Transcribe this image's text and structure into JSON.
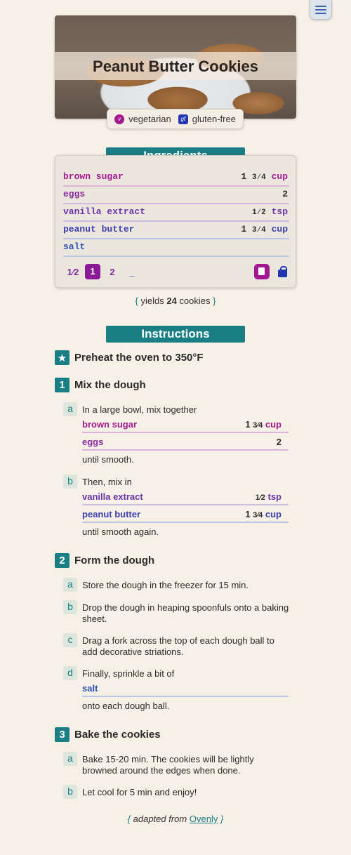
{
  "recipe": {
    "title": "Peanut Butter Cookies",
    "tags": [
      {
        "icon": "v",
        "label": "vegetarian"
      },
      {
        "icon": "gf",
        "label": "gluten-free"
      }
    ]
  },
  "ingredients": {
    "header": "Ingredients",
    "items": [
      {
        "name": "brown sugar",
        "whole": "1",
        "frac": "3⁄4",
        "unit": "cup"
      },
      {
        "name": "eggs",
        "whole": "2",
        "frac": "",
        "unit": ""
      },
      {
        "name": "vanilla extract",
        "whole": "",
        "frac": "1⁄2",
        "unit": "tsp"
      },
      {
        "name": "peanut butter",
        "whole": "1",
        "frac": "3⁄4",
        "unit": "cup"
      },
      {
        "name": "salt",
        "whole": "",
        "frac": "",
        "unit": ""
      }
    ],
    "scale_options": [
      "1⁄2",
      "1",
      "2",
      "_"
    ],
    "scale_selected": "1"
  },
  "yields": {
    "prefix": "yields",
    "count": "24",
    "unit": "cookies"
  },
  "instructions": {
    "header": "Instructions",
    "preheat": "Preheat the oven to 350°F",
    "steps": [
      {
        "number": "1",
        "title": "Mix the dough",
        "substeps": [
          {
            "letter": "a",
            "before": "In a large bowl, mix together",
            "after": "until smooth."
          },
          {
            "letter": "b",
            "before": "Then, mix in",
            "after": "until smooth again."
          }
        ]
      },
      {
        "number": "2",
        "title": "Form the dough",
        "substeps": [
          {
            "letter": "a",
            "text": "Store the dough in the freezer for 15 min."
          },
          {
            "letter": "b",
            "text": "Drop the dough in heaping spoonfuls onto a baking sheet."
          },
          {
            "letter": "c",
            "text": "Drag a fork across the top of each dough ball to add decorative striations."
          },
          {
            "letter": "d",
            "before": "Finally, sprinkle a bit of",
            "after": "onto each dough ball."
          }
        ]
      },
      {
        "number": "3",
        "title": "Bake the cookies",
        "substeps": [
          {
            "letter": "a",
            "text": "Bake 15-20 min. The cookies will be lightly browned around the edges when done."
          },
          {
            "letter": "b",
            "text": "Let cool for 5 min and enjoy!"
          }
        ]
      }
    ]
  },
  "footer": {
    "prefix": "adapted from",
    "link": "Ovenly"
  },
  "colors": {
    "accent": "#1a7f84",
    "background": "#f7f0e6",
    "ingredient_1": "#a2198f",
    "ingredient_5": "#2b50b3"
  }
}
